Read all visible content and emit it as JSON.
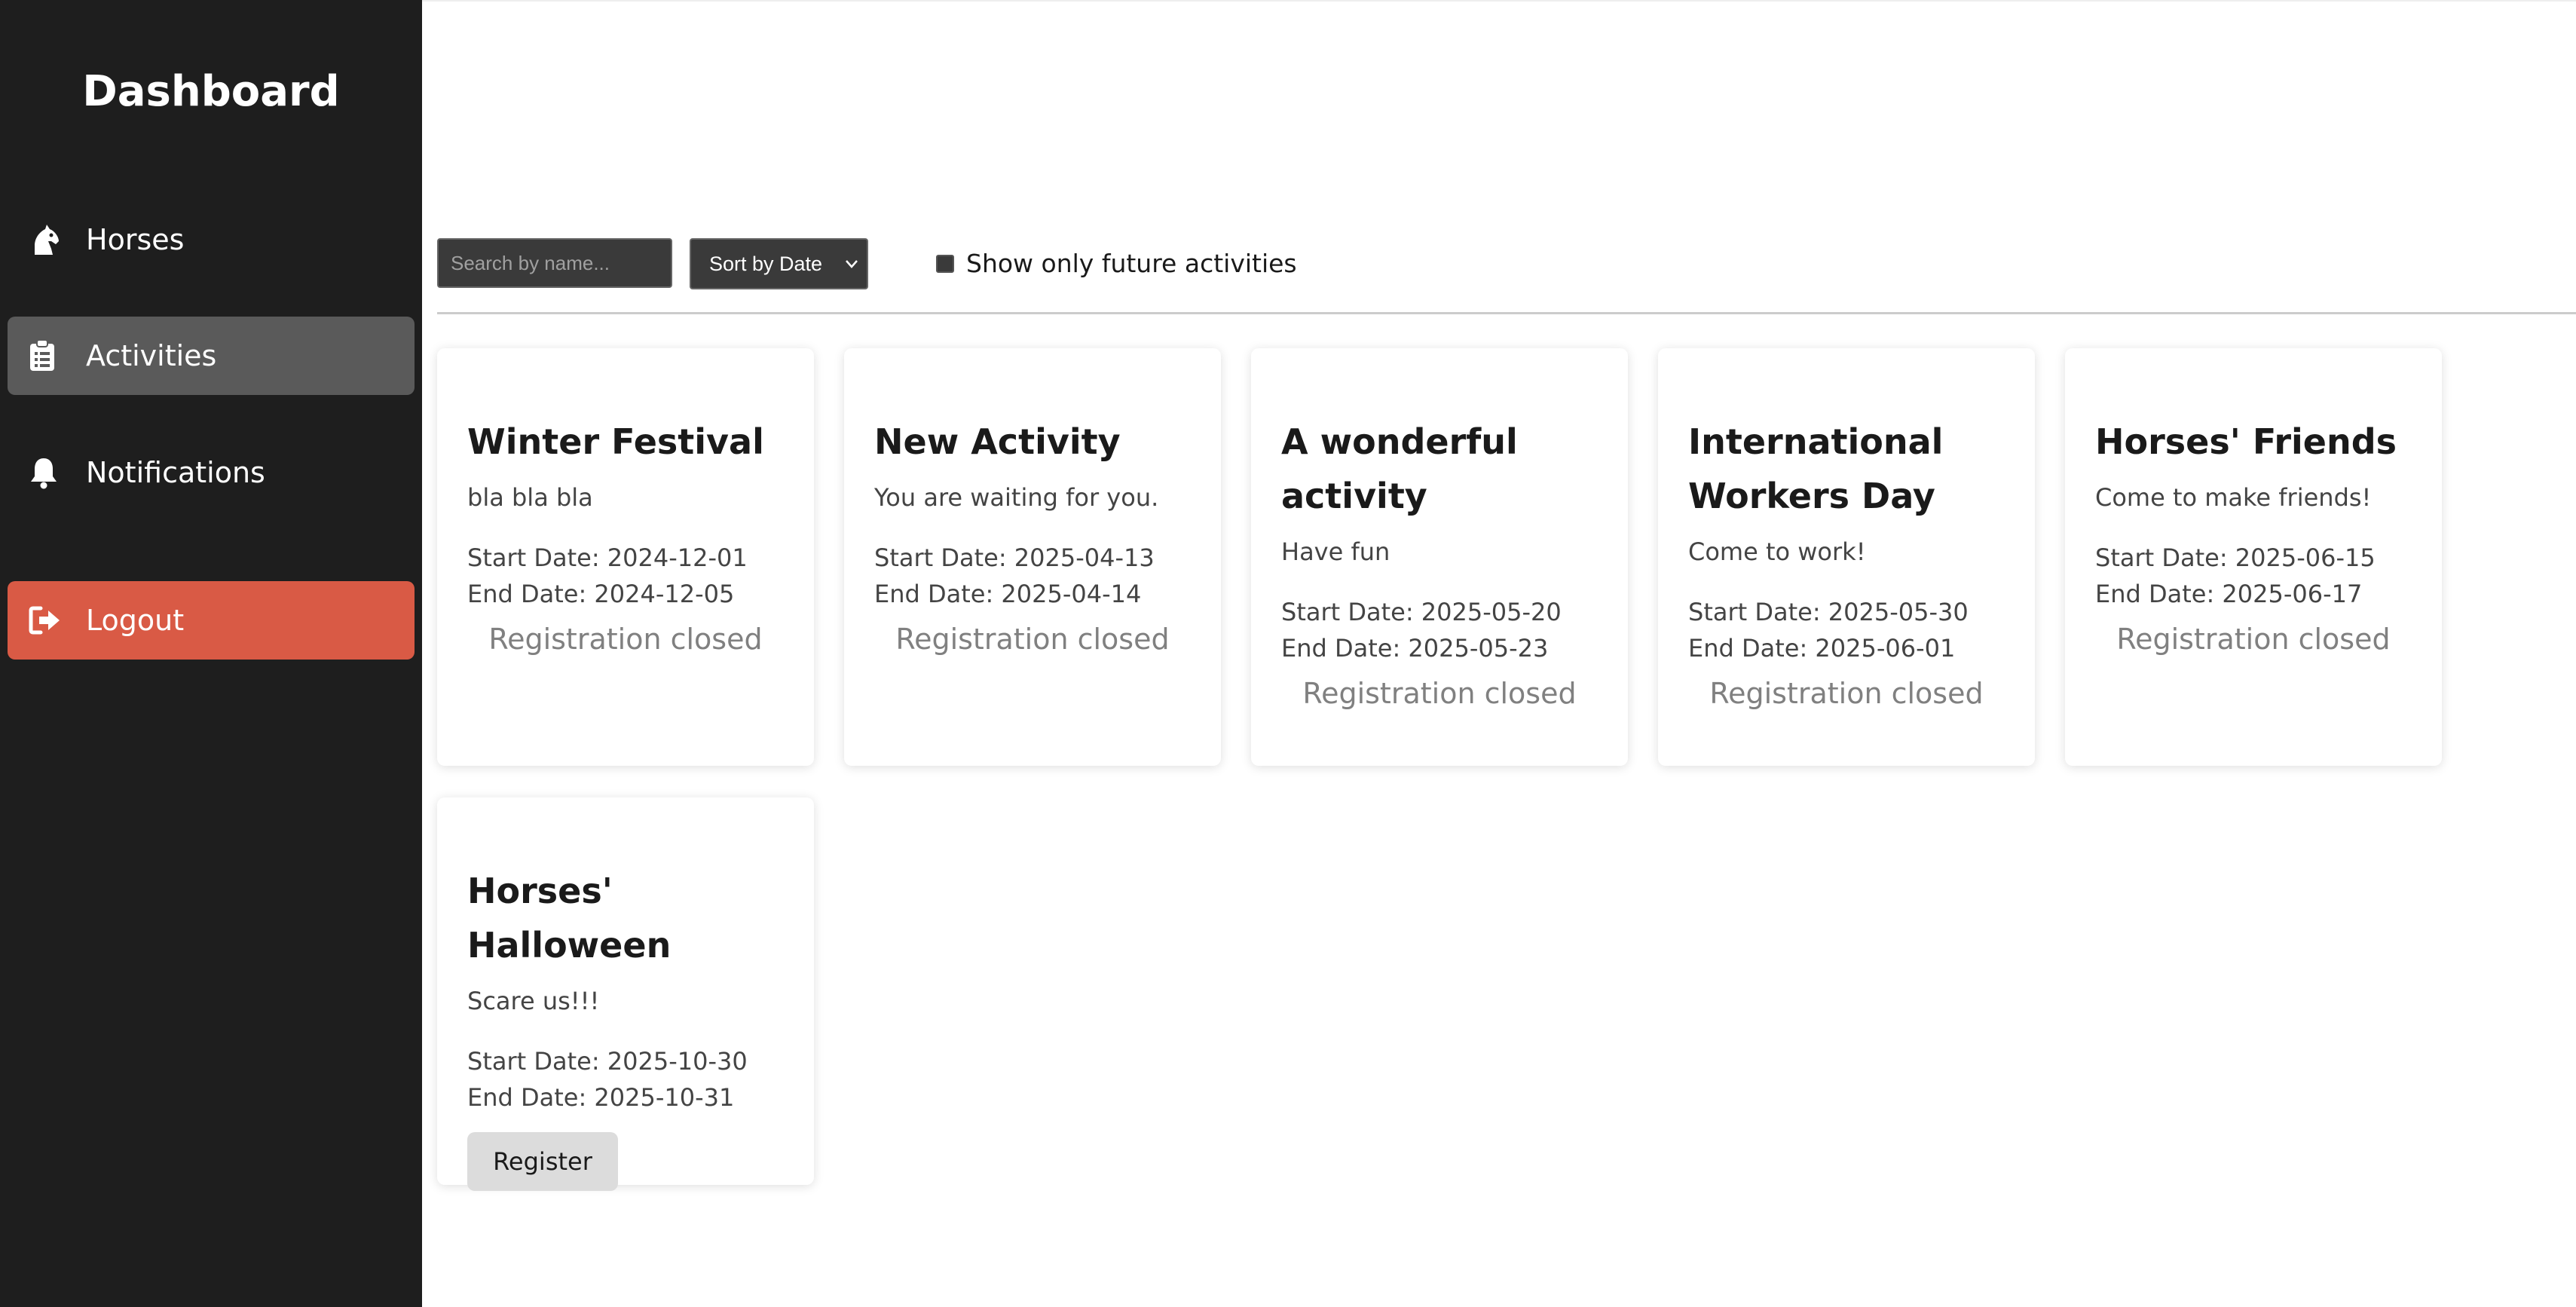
{
  "sidebar": {
    "title": "Dashboard",
    "items": [
      {
        "label": "Horses",
        "icon": "horse-head-icon"
      },
      {
        "label": "Activities",
        "icon": "clipboard-icon",
        "active": true
      },
      {
        "label": "Notifications",
        "icon": "bell-icon"
      }
    ],
    "logout": {
      "label": "Logout",
      "icon": "sign-out-icon"
    }
  },
  "filters": {
    "search_placeholder": "Search by name...",
    "search_value": "",
    "sort_label": "Sort by Date",
    "future_only_label": "Show only future activities",
    "future_only_checked": false
  },
  "colors": {
    "sidebar_bg": "#1e1e1e",
    "active_item_bg": "#5a5a5a",
    "logout_bg": "#d95a45",
    "register_button_bg": "#dcdcdc"
  },
  "activities": [
    {
      "title": "Winter Festival",
      "description": "bla bla bla",
      "start_date": "Start Date: 2024-12-01",
      "end_date": "End Date: 2024-12-05",
      "status": "Registration closed"
    },
    {
      "title": "New Activity",
      "description": "You are waiting for you.",
      "start_date": "Start Date: 2025-04-13",
      "end_date": "End Date: 2025-04-14",
      "status": "Registration closed"
    },
    {
      "title": "A wonderful activity",
      "description": "Have fun",
      "start_date": "Start Date: 2025-05-20",
      "end_date": "End Date: 2025-05-23",
      "status": "Registration closed"
    },
    {
      "title": "International Workers Day",
      "description": "Come to work!",
      "start_date": "Start Date: 2025-05-30",
      "end_date": "End Date: 2025-06-01",
      "status": "Registration closed"
    },
    {
      "title": "Horses' Friends",
      "description": "Come to make friends!",
      "start_date": "Start Date: 2025-06-15",
      "end_date": "End Date: 2025-06-17",
      "status": "Registration closed"
    },
    {
      "title": "Horses' Halloween",
      "description": "Scare us!!!",
      "start_date": "Start Date: 2025-10-30",
      "end_date": "End Date: 2025-10-31",
      "action": "Register"
    }
  ]
}
